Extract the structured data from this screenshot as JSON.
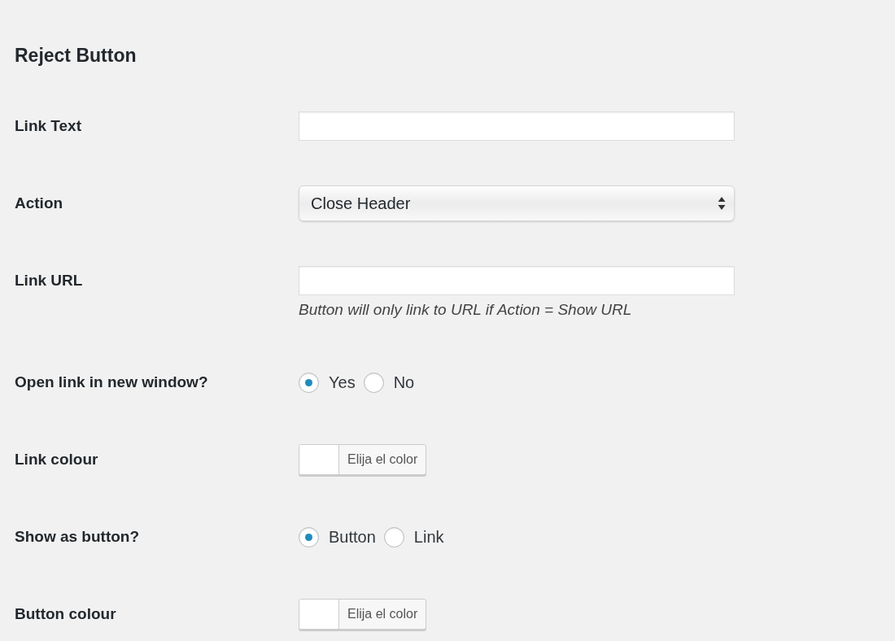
{
  "section_title": "Reject Button",
  "fields": [
    {
      "kind": "text",
      "label": "Link Text"
    },
    {
      "kind": "select",
      "label": "Action",
      "value": "Close Header"
    },
    {
      "kind": "text",
      "label": "Link URL",
      "help": "Button will only link to URL if Action = Show URL"
    },
    {
      "kind": "radio",
      "label": "Open link in new window?",
      "options": [
        {
          "label": "Yes",
          "selected": true
        },
        {
          "label": "No",
          "selected": false
        }
      ]
    },
    {
      "kind": "color",
      "label": "Link colour",
      "button": "Elija el color",
      "color": "#ffffff"
    },
    {
      "kind": "radio",
      "label": "Show as button?",
      "options": [
        {
          "label": "Button",
          "selected": true
        },
        {
          "label": "Link",
          "selected": false
        }
      ]
    },
    {
      "kind": "color",
      "label": "Button colour",
      "button": "Elija el color",
      "color": "#ffffff"
    }
  ]
}
